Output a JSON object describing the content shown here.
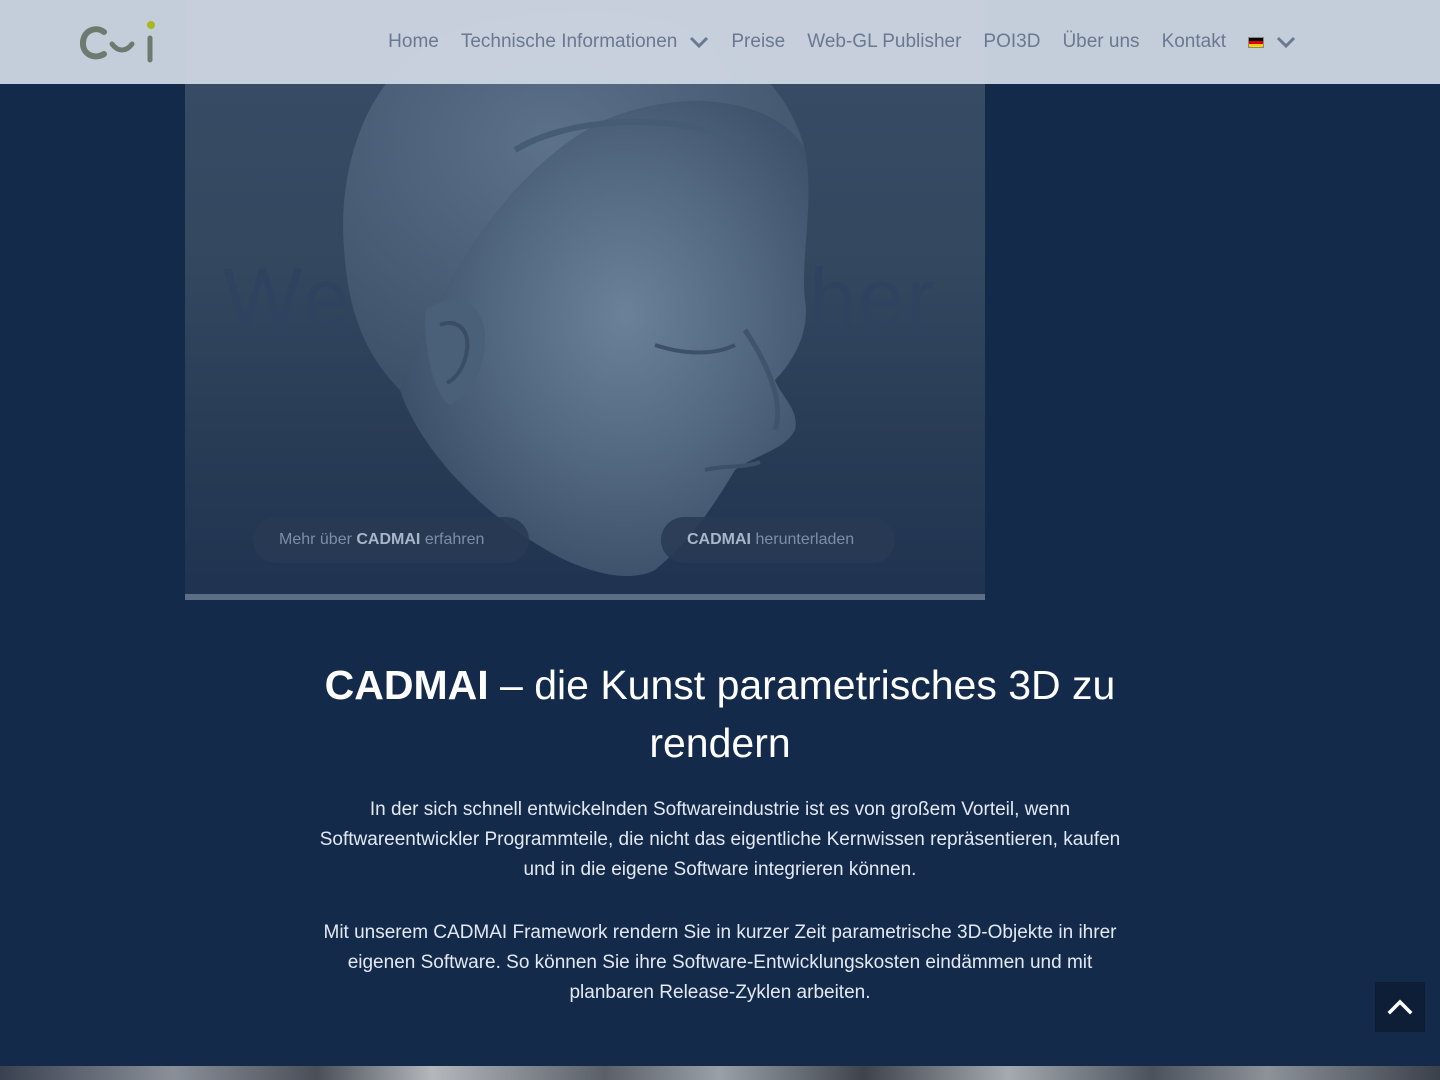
{
  "header": {
    "logo_text": "C~i",
    "nav": [
      {
        "label": "Home"
      },
      {
        "label": "Technische Informationen",
        "has_dropdown": true
      },
      {
        "label": "Preise"
      },
      {
        "label": "Web-GL Publisher"
      },
      {
        "label": "POI3D"
      },
      {
        "label": "Über uns"
      },
      {
        "label": "Kontakt"
      }
    ],
    "language": {
      "flag": "de-flag-icon",
      "has_dropdown": true
    }
  },
  "hero": {
    "background_text": "Web-GL Publisher",
    "button_more": {
      "prefix": "Mehr über ",
      "brand": "CADMAI",
      "suffix": " erfahren"
    },
    "button_download": {
      "brand": "CADMAI",
      "suffix": " herunterladen"
    }
  },
  "main": {
    "headline_brand": "CADMAI",
    "headline_rest": " – die Kunst parametrisches 3D zu rendern",
    "paragraph_1": "In der sich schnell entwickelnden Softwareindustrie ist es von großem Vorteil, wenn Softwareentwickler Programmteile, die nicht das eigentliche Kernwissen repräsentieren, kaufen und in die eigene Software integrieren können.",
    "paragraph_2": "Mit unserem CADMAI Framework rendern Sie in kurzer Zeit parametrische 3D-Objekte in ihrer eigenen Software. So können Sie ihre Software-Entwicklungskosten eindämmen und mit planbaren Release-Zyklen arbeiten."
  },
  "colors": {
    "page_background": "#142a4b",
    "header_background": "#ced6e2",
    "nav_text": "#6a7891",
    "headline_text": "#ffffff",
    "scroll_top_button": "#0e1e37"
  }
}
